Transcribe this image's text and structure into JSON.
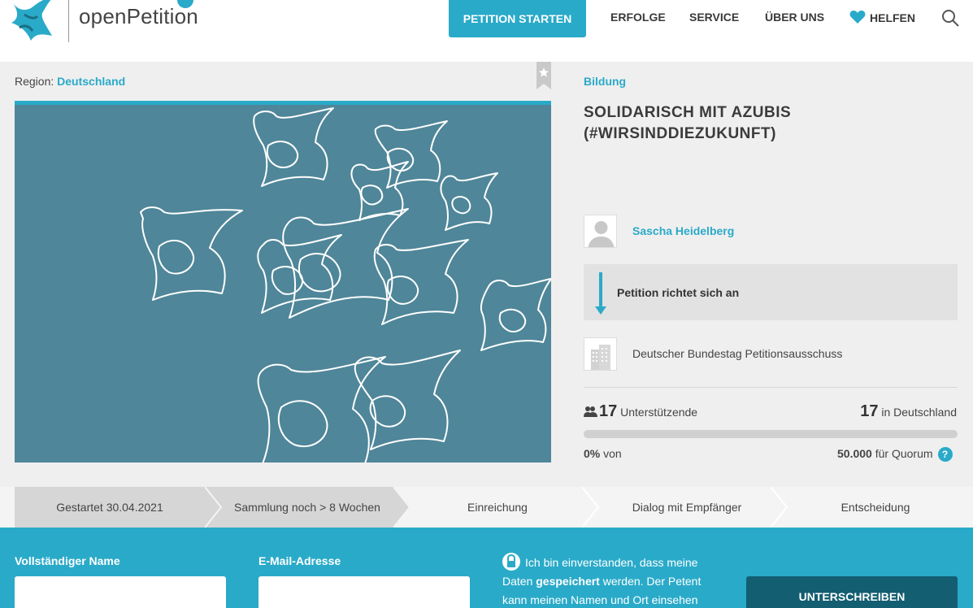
{
  "header": {
    "logo_text": "openPetition",
    "start_button": "PETITION STARTEN",
    "nav": [
      "ERFOLGE",
      "SERVICE",
      "ÜBER UNS",
      "HELFEN"
    ],
    "brand_color": "#2aaac9"
  },
  "petition": {
    "region_label": "Region:",
    "region_value": "Deutschland",
    "category": "Bildung",
    "title": "SOLIDARISCH MIT AZUBIS (#WIRSINDDIEZUKUNFT)",
    "author": "Sascha Heidelberg",
    "recipient_heading": "Petition richtet sich an",
    "recipient": "Deutscher Bundestag Petitionsausschuss",
    "supporters_count": "17",
    "supporters_label": "Unterstützende",
    "in_country_count": "17",
    "in_country_label": "in Deutschland",
    "progress_fraction": 0,
    "percent": "0%",
    "percent_suffix": "von",
    "quorum_value": "50.000",
    "quorum_label": "für Quorum",
    "help_symbol": "?"
  },
  "steps": [
    "Gestartet 30.04.2021",
    "Sammlung noch > 8 Wochen",
    "Einreichung",
    "Dialog mit Empfänger",
    "Entscheidung"
  ],
  "form": {
    "name_label": "Vollständiger Name",
    "email_label": "E-Mail-Adresse",
    "consent_pre": "Ich bin einverstanden, dass meine Daten ",
    "consent_bold": "gespeichert",
    "consent_post": " werden. Der Petent kann meinen Namen und Ort einsehen",
    "submit": "UNTERSCHREIBEN"
  }
}
